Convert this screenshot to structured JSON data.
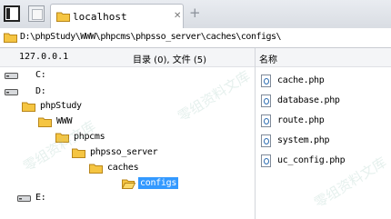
{
  "tabbar": {
    "tab_label": "localhost",
    "add_label": "+"
  },
  "address": {
    "path": "D:\\phpStudy\\WWW\\phpcms\\phpsso_server\\caches\\configs\\"
  },
  "header": {
    "ip": "127.0.0.1",
    "summary": "目录 (0), 文件 (5)",
    "name_column": "名称"
  },
  "tree": [
    {
      "label": "C:",
      "type": "drive",
      "expanded": false
    },
    {
      "label": "D:",
      "type": "drive",
      "expanded": true
    },
    {
      "label": "phpStudy",
      "type": "folder"
    },
    {
      "label": "WWW",
      "type": "folder"
    },
    {
      "label": "phpcms",
      "type": "folder"
    },
    {
      "label": "phpsso_server",
      "type": "folder"
    },
    {
      "label": "caches",
      "type": "folder"
    },
    {
      "label": "configs",
      "type": "folder",
      "selected": true
    },
    {
      "label": "E:",
      "type": "drive",
      "expanded": false
    }
  ],
  "files": [
    {
      "name": "cache.php"
    },
    {
      "name": "database.php"
    },
    {
      "name": "route.php"
    },
    {
      "name": "system.php"
    },
    {
      "name": "uc_config.php"
    }
  ],
  "watermark": "零组资料文库",
  "colors": {
    "selection": "#3399ff",
    "folder": "#f5c542"
  }
}
